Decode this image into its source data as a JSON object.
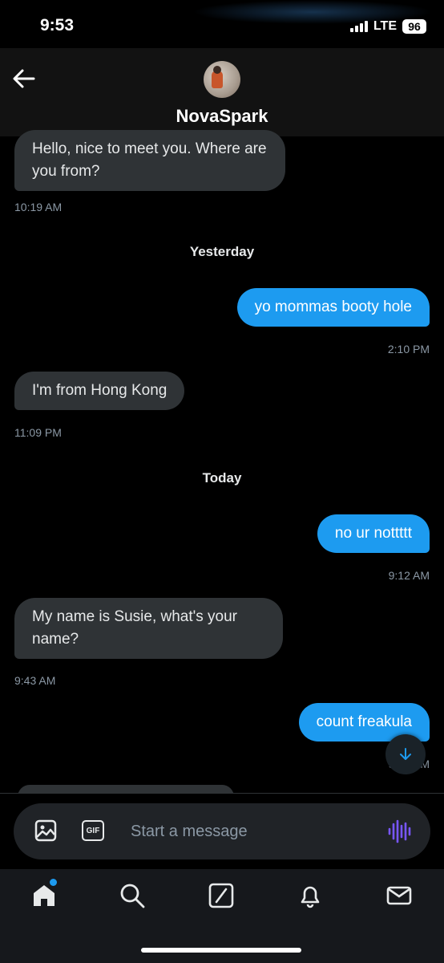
{
  "status_bar": {
    "time": "9:53",
    "network": "LTE",
    "battery": "96"
  },
  "header": {
    "contact_name": "NovaSpark"
  },
  "messages": [
    {
      "text": "Hello, nice to meet you. Where are you from?",
      "time": "10:19 AM"
    },
    {
      "text": "yo mommas booty hole",
      "time": "2:10 PM"
    },
    {
      "text": "I'm from Hong Kong",
      "time": "11:09 PM"
    },
    {
      "text": "no ur nottttt",
      "time": "9:12 AM"
    },
    {
      "text": "My name is Susie, what's your name?",
      "time": "9:43 AM"
    },
    {
      "text": "count freakula",
      "time": "9:43 AM"
    }
  ],
  "day_separators": [
    "Yesterday",
    "Today"
  ],
  "composer": {
    "placeholder": "Start a message",
    "gif_label": "GIF"
  },
  "colors": {
    "accent": "#1d9bf0",
    "incoming_bubble": "#2f3336",
    "voice": "#7856ff"
  },
  "icons": {
    "back": "arrow-left-icon",
    "media": "image-icon",
    "voice": "voice-wave-icon",
    "scroll": "arrow-down-icon",
    "tabs": [
      "home-icon",
      "search-icon",
      "grok-icon",
      "bell-icon",
      "mail-icon"
    ]
  }
}
